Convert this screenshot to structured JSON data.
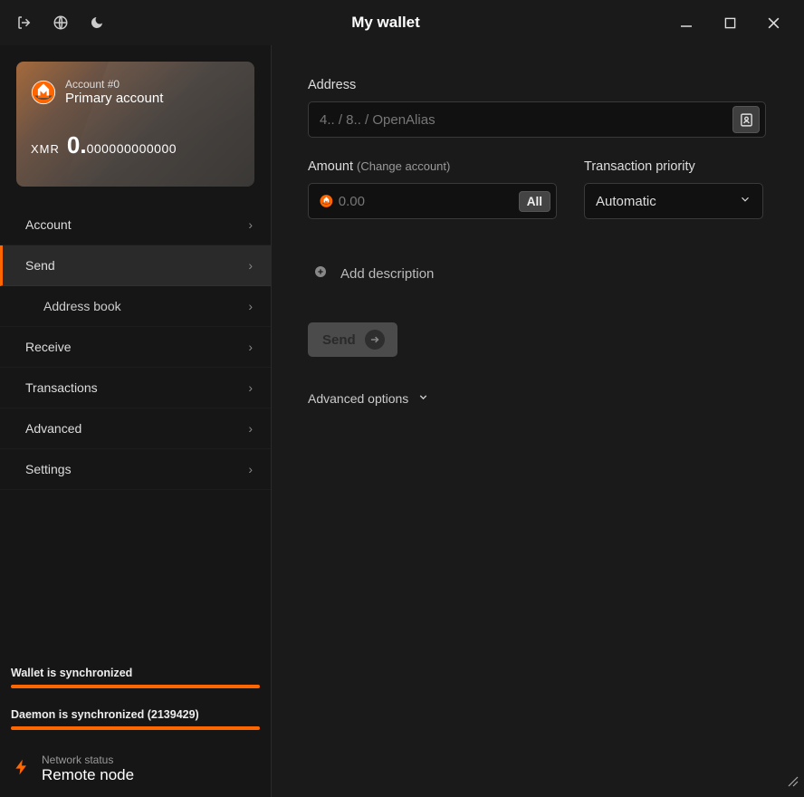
{
  "title": "My wallet",
  "sidebar": {
    "account": {
      "number": "Account #0",
      "name": "Primary account",
      "currency": "XMR",
      "balance_whole": "0.",
      "balance_decimals": "000000000000"
    },
    "nav": {
      "account": "Account",
      "send": "Send",
      "address_book": "Address book",
      "receive": "Receive",
      "transactions": "Transactions",
      "advanced": "Advanced",
      "settings": "Settings"
    },
    "sync_wallet": "Wallet is synchronized",
    "sync_daemon": "Daemon is synchronized (2139429)",
    "network": {
      "label": "Network status",
      "value": "Remote node"
    }
  },
  "form": {
    "address_label": "Address",
    "address_placeholder": "4.. / 8.. / OpenAlias",
    "amount_label": "Amount",
    "amount_hint": "(Change account)",
    "amount_placeholder": "0.00",
    "all_btn": "All",
    "priority_label": "Transaction priority",
    "priority_value": "Automatic",
    "add_description": "Add description",
    "send_btn": "Send",
    "advanced_options": "Advanced options"
  }
}
